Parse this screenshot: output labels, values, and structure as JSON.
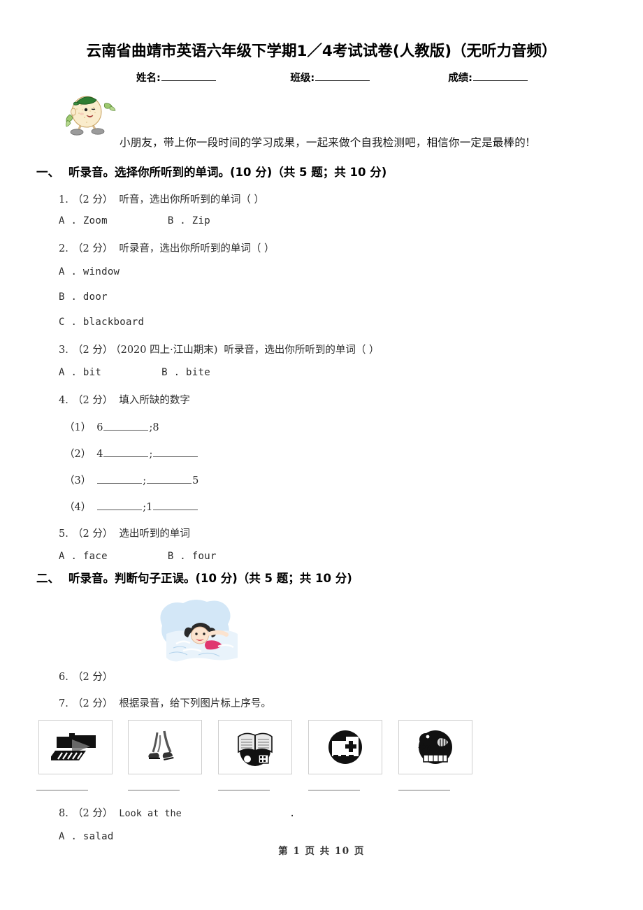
{
  "document": {
    "title": "云南省曲靖市英语六年级下学期1／4考试试卷(人教版)（无听力音频）",
    "intro_text": "小朋友，带上你一段时间的学习成果，一起来做个自我检测吧，相信你一定是最棒的!",
    "footer": "第 1 页 共 10 页"
  },
  "meta": {
    "name_label": "姓名:",
    "class_label": "班级:",
    "score_label": "成绩:"
  },
  "sections": [
    {
      "num": "一、",
      "title": "听录音。选择你所听到的单词。(10 分)（共 5 题；共 10 分)"
    },
    {
      "num": "二、",
      "title": "听录音。判断句子正误。(10 分)（共 5 题；共 10 分)"
    }
  ],
  "questions": {
    "q1": {
      "num": "1.",
      "points": "（2 分）",
      "text": "听音，选出你所听到的单词（      ）",
      "option_a": "A . Zoom",
      "option_b": "B . Zip"
    },
    "q2": {
      "num": "2.",
      "points": "（2 分）",
      "text": "听录音，选出你所听到的单词（      ）",
      "option_a": "A . window",
      "option_b": "B . door",
      "option_c": "C . blackboard"
    },
    "q3": {
      "num": "3.",
      "points": "（2 分）",
      "tag": "（2020 四上·江山期末)",
      "text": "听录音，选出你所听到的单词（      ）",
      "option_a": "A . bit",
      "option_b": "B . bite"
    },
    "q4": {
      "num": "4.",
      "points": "（2 分）",
      "text": "填入所缺的数字",
      "sub": [
        {
          "label": "（1）",
          "before": "6",
          "mid": ";8",
          "after": ""
        },
        {
          "label": "（2）",
          "before": "4",
          "mid": ";",
          "after": ""
        },
        {
          "label": "（3）",
          "before": "",
          "mid": ";",
          "after": "5"
        },
        {
          "label": "（4）",
          "before": "",
          "mid": ";1",
          "after": ""
        }
      ]
    },
    "q5": {
      "num": "5.",
      "points": "（2 分）",
      "text": "选出听到的单词",
      "option_a": "A . face",
      "option_b": "B . four"
    },
    "q6": {
      "num": "6.",
      "points": "（2 分）",
      "text": ""
    },
    "q7": {
      "num": "7.",
      "points": "（2 分）",
      "text": "根据录音，给下列图片标上序号。",
      "pictures": [
        "projector-screen-icon",
        "walking-feet-icon",
        "library-book-icon",
        "hospital-cross-icon",
        "park-fountain-icon"
      ]
    },
    "q8": {
      "num": "8.",
      "points": "（2 分）",
      "text": "Look at the",
      "text_tail": ".",
      "option_a": "A . salad"
    }
  },
  "colors": {
    "text": "#1a1a1a",
    "muted": "#2b2b2b",
    "rule": "#555555",
    "pic_border": "#cfcfcf",
    "mascot_body": "#f7e7c8",
    "mascot_cap": "#2f7d32",
    "mascot_leaf": "#8fbf63",
    "mascot_shoe": "#9b9b9b",
    "water_blue": "#cfe4f5",
    "swim_suit": "#e0366f"
  }
}
